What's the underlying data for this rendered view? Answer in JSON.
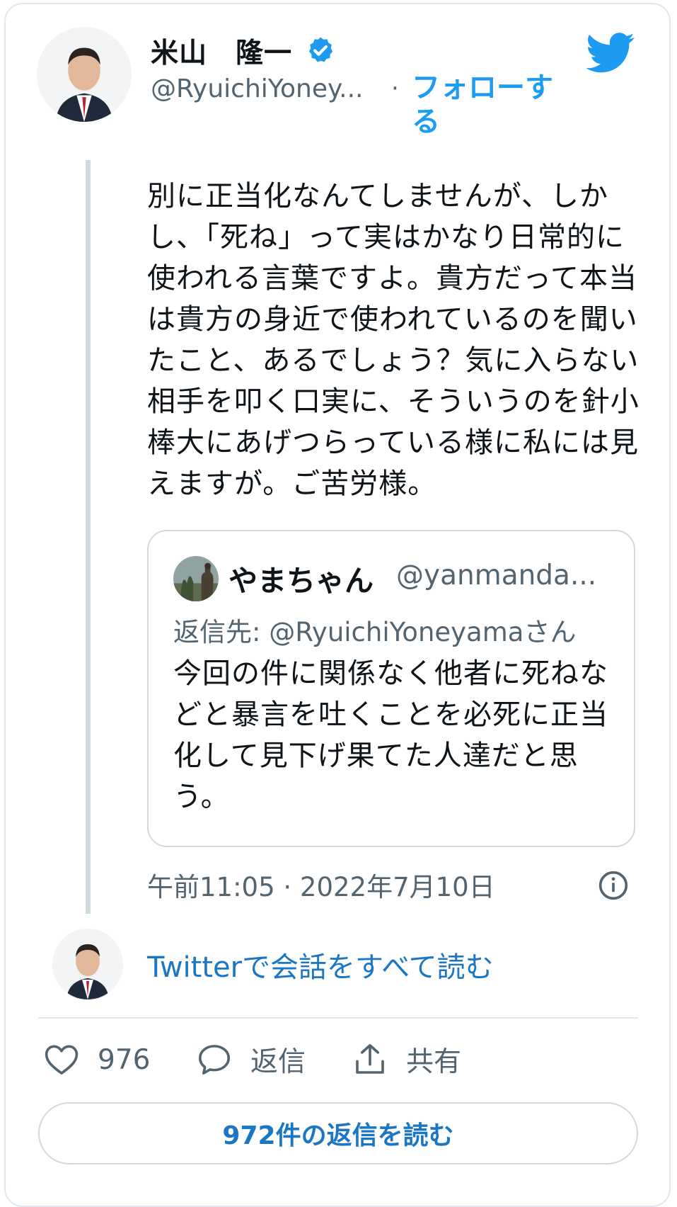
{
  "author": {
    "name": "米山　隆一",
    "handle": "@RyuichiYoney...",
    "follow_label": "フォローする",
    "separator": "·"
  },
  "tweet": {
    "text": "別に正当化なんてしませんが、しかし、「死ね」って実はかなり日常的に使われる言葉ですよ。貴方だって本当は貴方の身近で使われているのを聞いたこと、あるでしょう？気に入らない相手を叩く口実に、そういうのを針小棒大にあげつらっている様に私には見えますが。ご苦労様。",
    "timestamp": "午前11:05 · 2022年7月10日"
  },
  "quote": {
    "name": "やまちゃん",
    "handle": "@yanmanda...",
    "reply_prefix": "返信先:",
    "reply_to": "@RyuichiYoneyamaさん",
    "text": "今回の件に関係なく他者に死ねなどと暴言を吐くことを必死に正当化して見下げ果てた人達だと思う。"
  },
  "conversation": {
    "link_label": "Twitterで会話をすべて読む"
  },
  "actions": {
    "like_count": "976",
    "reply_label": "返信",
    "share_label": "共有"
  },
  "read_replies": {
    "label": "972件の返信を読む"
  },
  "icons": {
    "verified": "verified-badge-icon",
    "brand": "twitter-bird-icon",
    "info": "info-icon",
    "like": "heart-icon",
    "reply": "speech-bubble-icon",
    "share": "share-upload-icon"
  },
  "colors": {
    "accent": "#1d9bf0",
    "link": "#1b76c4",
    "secondary_text": "#536471",
    "border": "#cfd9de"
  }
}
